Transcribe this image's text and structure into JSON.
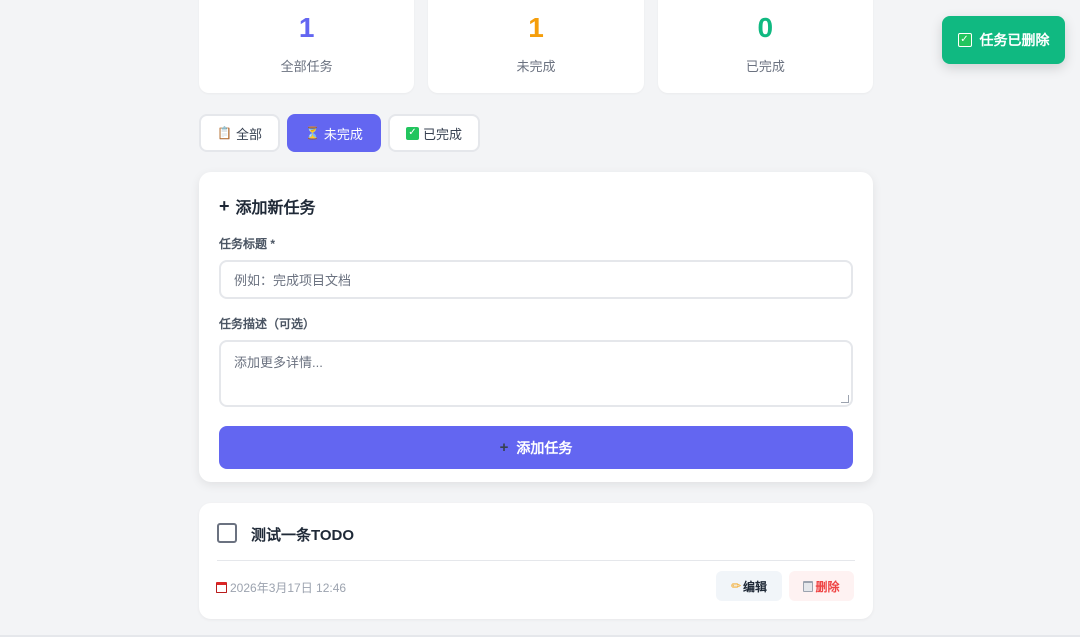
{
  "stats": [
    {
      "value": "1",
      "label": "全部任务",
      "color": "#6366f1"
    },
    {
      "value": "1",
      "label": "未完成",
      "color": "#f59e0b"
    },
    {
      "value": "0",
      "label": "已完成",
      "color": "#10b981"
    }
  ],
  "filters": [
    {
      "label": "全部",
      "icon": "clipboard-icon"
    },
    {
      "label": "未完成",
      "icon": "hourglass-icon",
      "active": true
    },
    {
      "label": "已完成",
      "icon": "check-icon"
    }
  ],
  "add_form": {
    "title": "添加新任务",
    "title_label": "任务标题 *",
    "title_placeholder": "例如：完成项目文档",
    "desc_label": "任务描述（可选）",
    "desc_placeholder": "添加更多详情...",
    "submit_label": "添加任务"
  },
  "todos": [
    {
      "title": "测试一条TODO",
      "date": "2026年3月17日 12:46",
      "edit_label": "编辑",
      "delete_label": "删除"
    }
  ],
  "toast": {
    "message": "任务已删除"
  },
  "colors": {
    "accent": "#6366f1",
    "success": "#10b981",
    "warning": "#f59e0b",
    "danger": "#ef4444"
  }
}
